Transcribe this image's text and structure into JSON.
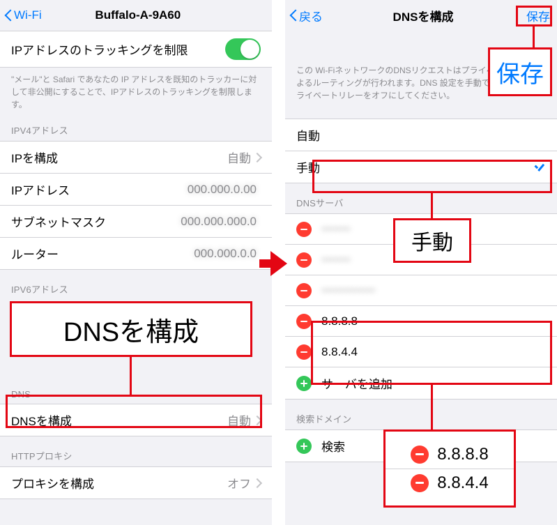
{
  "annotations": {
    "callout_dns": "DNSを構成",
    "callout_save": "保存",
    "callout_manual": "手動",
    "callout_dns1": "8.8.8.8",
    "callout_dns2": "8.8.4.4"
  },
  "left": {
    "nav_back": "Wi-Fi",
    "nav_title": "Buffalo-A-9A60",
    "limit_tracking": "IPアドレスのトラッキングを制限",
    "tracking_footer": "\"メール\"と Safari であなたの IP アドレスを既知のトラッカーに対して非公開にすることで、IPアドレスのトラッキングを制限します。",
    "ipv4_header": "IPV4アドレス",
    "configure_ip": "IPを構成",
    "configure_ip_value": "自動",
    "ip_address": "IPアドレス",
    "subnet": "サブネットマスク",
    "router": "ルーター",
    "ipv6_header": "IPV6アドレス",
    "dns_header": "DNS",
    "configure_dns": "DNSを構成",
    "configure_dns_value": "自動",
    "proxy_header": "HTTPプロキシ",
    "configure_proxy": "プロキシを構成",
    "configure_proxy_value": "オフ"
  },
  "right": {
    "nav_back": "戻る",
    "nav_title": "DNSを構成",
    "nav_save": "保存",
    "help_footer": "この Wi-FiネットワークのDNSリクエストはプライベートリレーによるルーティングが行われます。DNS 設定を手動で行うには、プライベートリレーをオフにしてください。",
    "mode_auto": "自動",
    "mode_manual": "手動",
    "servers_header": "DNSサーバ",
    "server_1": "•••••••",
    "server_2": "•••••••",
    "server_3": "•••••••••••••",
    "server_4": "8.8.8.8",
    "server_5": "8.8.4.4",
    "add_server": "サーバを追加",
    "search_header": "検索ドメイン",
    "add_search": "検索"
  }
}
